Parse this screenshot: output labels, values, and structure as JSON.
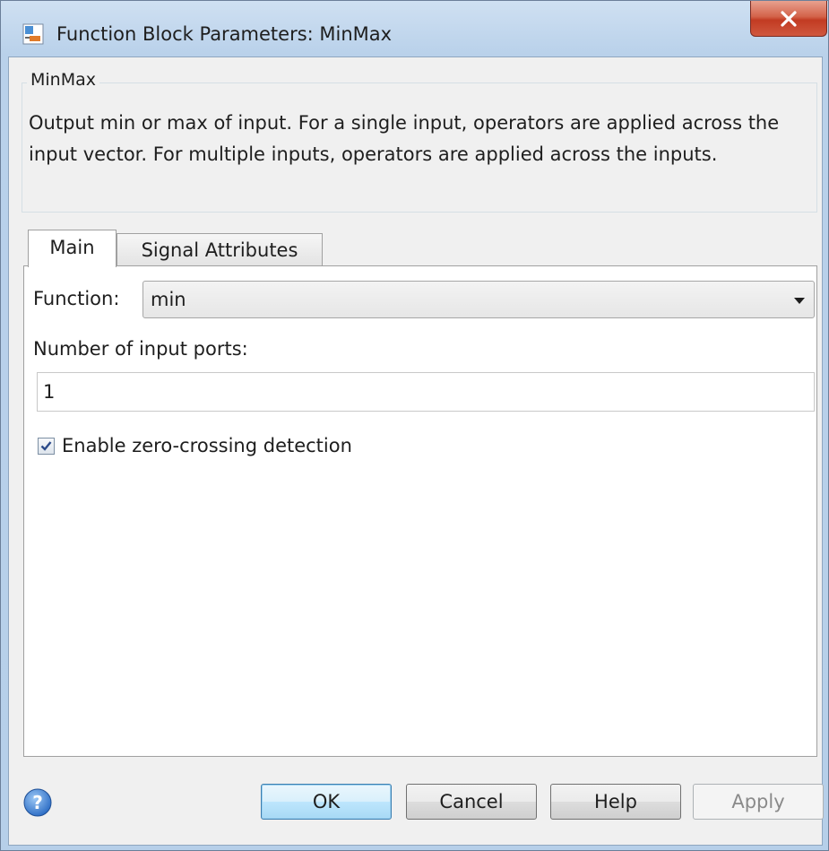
{
  "window": {
    "title": "Function Block Parameters: MinMax",
    "close_label": "x"
  },
  "block": {
    "group_title": "MinMax",
    "description": "Output min or max of input.  For a single input, operators are applied across the input vector.  For multiple inputs, operators are applied across the inputs."
  },
  "tabs": [
    {
      "label": "Main",
      "selected": true
    },
    {
      "label": "Signal Attributes",
      "selected": false
    }
  ],
  "main": {
    "function_label": "Function:",
    "function_value": "min",
    "ports_label": "Number of input ports:",
    "ports_value": "1",
    "zero_crossing_label": "Enable zero-crossing detection",
    "zero_crossing_checked": true
  },
  "buttons": {
    "ok": "OK",
    "cancel": "Cancel",
    "help": "Help",
    "apply": "Apply"
  },
  "icons": {
    "app": "simulink-block-icon",
    "close": "close-icon",
    "help": "help-question-icon",
    "checkmark": "checkmark-icon",
    "dropdown": "chevron-down-icon"
  },
  "colors": {
    "close_button": "#c23b22",
    "ok_border": "#3c7fb1",
    "help_icon": "#2f6fc6"
  }
}
